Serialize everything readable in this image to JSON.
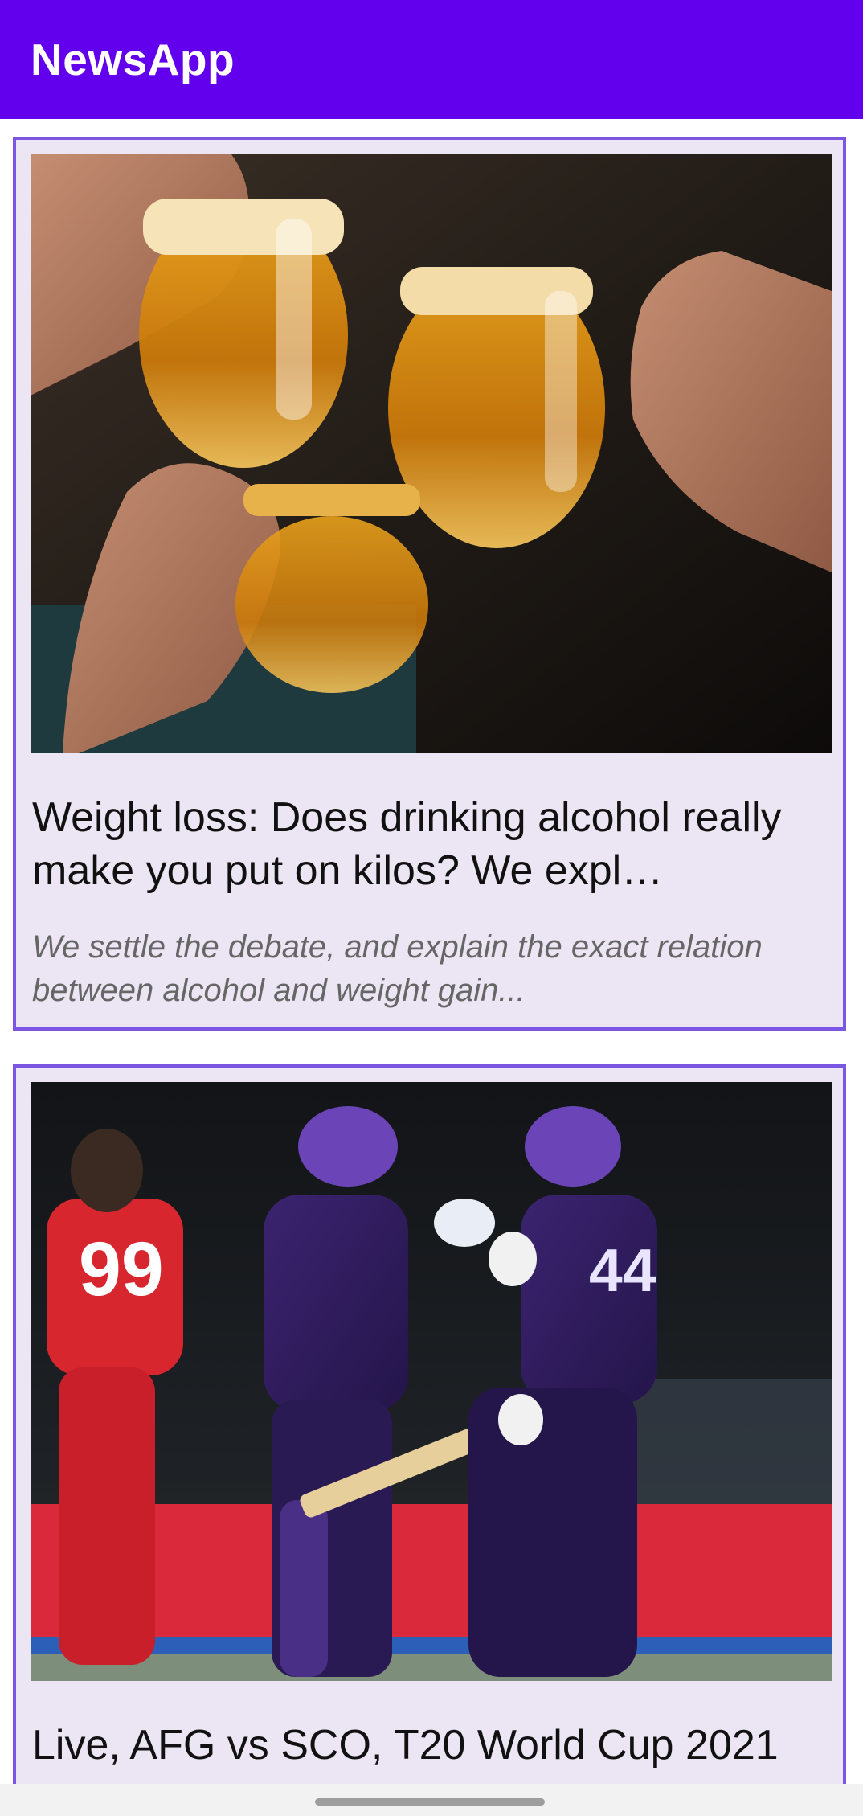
{
  "app_bar": {
    "title": "NewsApp",
    "color": "#6200ee"
  },
  "articles": [
    {
      "title": "Weight loss: Does drinking alcohol really make you put on kilos? We expl…",
      "description": "We settle the debate, and explain the exact relation between alcohol and weight gain...",
      "image_icon": "beer-mugs-toast-photo"
    },
    {
      "title": "Live, AFG vs SCO, T20 World Cup 2021",
      "image_icon": "cricket-players-photo"
    }
  ],
  "colors": {
    "card_border": "#7b56e2",
    "card_background": "#ece6f4"
  }
}
